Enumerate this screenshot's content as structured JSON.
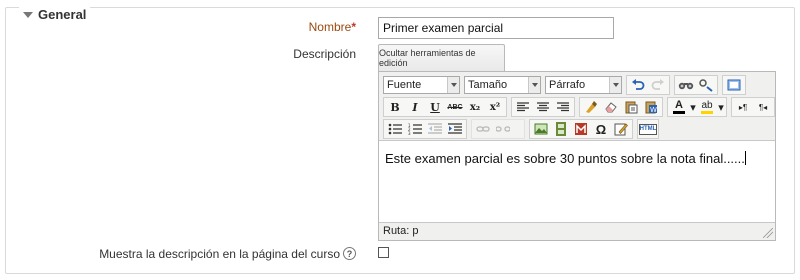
{
  "section": {
    "title": "General"
  },
  "name_field": {
    "label": "Nombre",
    "required_mark": "*",
    "value": "Primer examen parcial"
  },
  "description_field": {
    "label": "Descripción",
    "toggle_label": "Ocultar herramientas de edición"
  },
  "editor": {
    "font_select": "Fuente",
    "size_select": "Tamaño",
    "format_select": "Párrafo",
    "bold": "B",
    "italic": "I",
    "underline": "U",
    "strike": "ABC",
    "subscript": "x₂",
    "superscript": "x²",
    "omega": "Ω",
    "html": "HTML",
    "text_color": "A",
    "highlight": "ab",
    "ltr": "▸¶",
    "rtl": "¶◂",
    "content": "Este examen parcial es sobre 30 puntos sobre la nota final......",
    "path_label": "Ruta: p"
  },
  "show_description": {
    "label": "Muestra la descripción en la página del curso",
    "help": "?",
    "checked": false
  }
}
